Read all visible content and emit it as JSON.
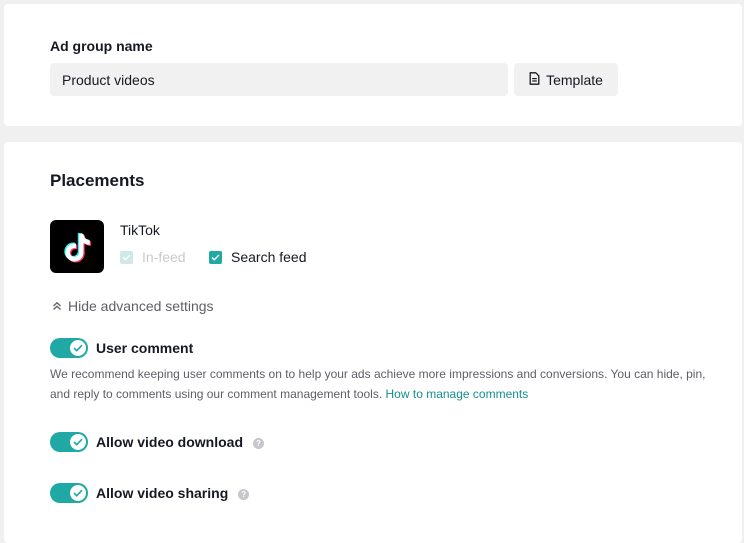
{
  "ad_group": {
    "label": "Ad group name",
    "value": "Product videos",
    "template_button": "Template"
  },
  "placements": {
    "title": "Placements",
    "app": {
      "name": "TikTok",
      "icon": "tiktok-logo"
    },
    "options": [
      {
        "label": "In-feed",
        "checked": true,
        "disabled": true
      },
      {
        "label": "Search feed",
        "checked": true,
        "disabled": false
      }
    ]
  },
  "advanced": {
    "toggle_label": "Hide advanced settings",
    "user_comment": {
      "label": "User comment",
      "enabled": true,
      "description": "We recommend keeping user comments on to help your ads achieve more impressions and conversions. You can hide, pin, and reply to comments using our comment management tools.",
      "link": "How to manage comments"
    },
    "video_download": {
      "label": "Allow video download",
      "enabled": true
    },
    "video_sharing": {
      "label": "Allow video sharing",
      "enabled": true
    }
  },
  "colors": {
    "accent": "#1fa8a4",
    "link": "#138f8c",
    "muted_text": "#5d5f66",
    "background": "#f0f0f0"
  }
}
